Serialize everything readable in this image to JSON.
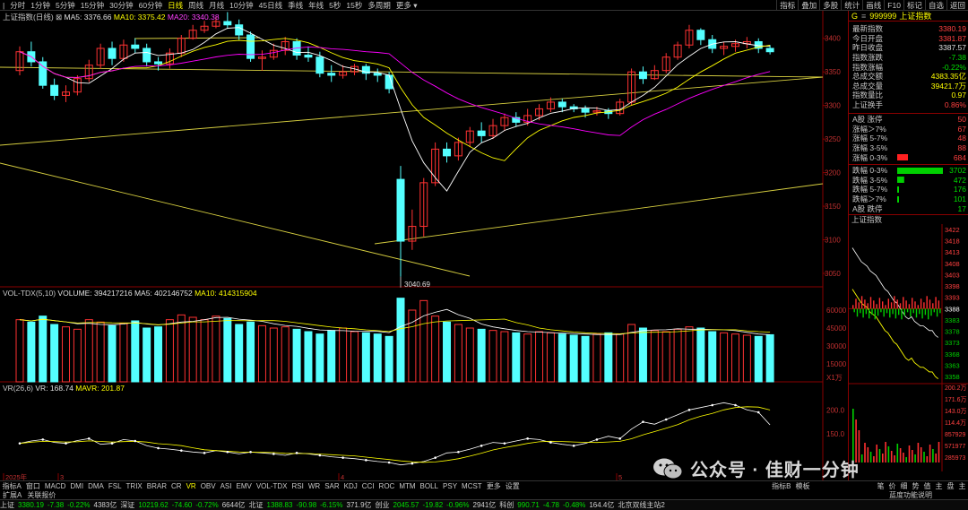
{
  "toolbar": {
    "timeframes": [
      "分时",
      "1分钟",
      "5分钟",
      "15分钟",
      "30分钟",
      "60分钟",
      "日线",
      "周线",
      "月线",
      "10分钟",
      "45日线",
      "季线",
      "年线",
      "5秒",
      "15秒",
      "多周期",
      "更多"
    ],
    "active_timeframe": "日线",
    "right_items": [
      "指标",
      "叠加",
      "多股",
      "统计",
      "画线",
      "F10",
      "标记",
      "自选",
      "返回"
    ]
  },
  "price_header": {
    "title": "上证指数(日线)",
    "ma5_label": "MA5: 3376.66",
    "ma10_label": "MA10: 3375.42",
    "ma20_label": "MA20: 3340.38",
    "high_label": "3439.05",
    "low_label": "3040.69"
  },
  "price_axis": [
    "3400",
    "3350",
    "3300",
    "3250",
    "3200",
    "3150",
    "3100",
    "3050"
  ],
  "vol_header": {
    "title": "VOL-TDX(5,10)",
    "volume": "VOLUME: 394217216",
    "ma5": "MA5: 402146752",
    "ma10": "MA10: 414315904"
  },
  "vol_axis": [
    "60000",
    "45000",
    "30000",
    "15000"
  ],
  "vol_unit": "X1万",
  "vr_header": {
    "title": "VR(26,6)",
    "vr": "VR: 168.74",
    "mavr": "MAVR: 201.87"
  },
  "vr_axis": [
    "200.0",
    "150.0"
  ],
  "date_labels": [
    "2025年",
    "3",
    "4",
    "5"
  ],
  "sidebar": {
    "code": "999999",
    "name": "上证指数",
    "stats": [
      {
        "label": "最新指数",
        "value": "3380.19",
        "color": "red"
      },
      {
        "label": "今日开盘",
        "value": "3381.87",
        "color": "red"
      },
      {
        "label": "昨日收盘",
        "value": "3387.57",
        "color": "white"
      },
      {
        "label": "指数涨跌",
        "value": "-7.38",
        "color": "green"
      },
      {
        "label": "指数涨幅",
        "value": "-0.22%",
        "color": "green"
      },
      {
        "label": "总成交额",
        "value": "4383.35亿",
        "color": "yellow"
      },
      {
        "label": "总成交量",
        "value": "39421.7万",
        "color": "yellow"
      },
      {
        "label": "指数量比",
        "value": "0.97",
        "color": "yellow"
      },
      {
        "label": "上证换手",
        "value": "0.86%",
        "color": "red"
      }
    ],
    "up_dist": [
      {
        "label": "A股 涨停",
        "value": "50",
        "pct": 0
      },
      {
        "label": "涨幅＞7%",
        "value": "67",
        "pct": 0
      },
      {
        "label": "涨幅 5-7%",
        "value": "48",
        "pct": 0
      },
      {
        "label": "涨幅 3-5%",
        "value": "88",
        "pct": 0
      },
      {
        "label": "涨幅 0-3%",
        "value": "684",
        "pct": 0.2
      }
    ],
    "down_dist": [
      {
        "label": "跌幅 0-3%",
        "value": "3702",
        "pct": 1.0
      },
      {
        "label": "跌幅 3-5%",
        "value": "472",
        "pct": 0.13
      },
      {
        "label": "跌幅 5-7%",
        "value": "176",
        "pct": 0.04
      },
      {
        "label": "跌幅＞7%",
        "value": "101",
        "pct": 0.02
      },
      {
        "label": "A股 跌停",
        "value": "17",
        "pct": 0
      }
    ],
    "mini_title": "上证指数",
    "mini_axis": [
      "3422",
      "3418",
      "3413",
      "3408",
      "3403",
      "3398",
      "3393",
      "3388",
      "3383",
      "3378",
      "3373",
      "3368",
      "3363",
      "3358"
    ],
    "mini_vol_axis": [
      "200.2万",
      "171.6万",
      "143.0万",
      "114.4万",
      "857929",
      "571977",
      "285973"
    ],
    "mini_tabs": [
      "笔",
      "价",
      "细",
      "势",
      "值",
      "主",
      "盘",
      "主"
    ]
  },
  "bottom_tabs": [
    "指标A",
    "窗口",
    "MACD",
    "DMI",
    "DMA",
    "FSL",
    "TRIX",
    "BRAR",
    "CR",
    "VR",
    "OBV",
    "ASI",
    "EMV",
    "VOL-TDX",
    "RSI",
    "WR",
    "SAR",
    "KDJ",
    "CCI",
    "ROC",
    "MTM",
    "BOLL",
    "PSY",
    "MCST",
    "更多",
    "设置"
  ],
  "active_bottom_tab": "VR",
  "bottom_right": [
    "指标B",
    "模板"
  ],
  "row2": [
    "扩展A",
    "关联报价"
  ],
  "row2_right": "蓝度功能说明",
  "status": [
    {
      "text": "上证",
      "color": "white"
    },
    {
      "text": "3380.19",
      "color": "green"
    },
    {
      "text": "-7.38",
      "color": "green"
    },
    {
      "text": "-0.22%",
      "color": "green"
    },
    {
      "text": "4383亿",
      "color": "white"
    },
    {
      "text": "深证",
      "color": "white"
    },
    {
      "text": "10219.62",
      "color": "green"
    },
    {
      "text": "-74.60",
      "color": "green"
    },
    {
      "text": "-0.72%",
      "color": "green"
    },
    {
      "text": "6644亿",
      "color": "white"
    },
    {
      "text": "北证",
      "color": "white"
    },
    {
      "text": "1388.83",
      "color": "green"
    },
    {
      "text": "-90.98",
      "color": "green"
    },
    {
      "text": "-6.15%",
      "color": "green"
    },
    {
      "text": "371.9亿",
      "color": "white"
    },
    {
      "text": "创业",
      "color": "white"
    },
    {
      "text": "2045.57",
      "color": "green"
    },
    {
      "text": "-19.82",
      "color": "green"
    },
    {
      "text": "-0.96%",
      "color": "green"
    },
    {
      "text": "2941亿",
      "color": "white"
    },
    {
      "text": "科创",
      "color": "white"
    },
    {
      "text": "990.71",
      "color": "green"
    },
    {
      "text": "-4.78",
      "color": "green"
    },
    {
      "text": "-0.48%",
      "color": "green"
    },
    {
      "text": "164.4亿",
      "color": "white"
    },
    {
      "text": "北京双线主站2",
      "color": "white"
    }
  ],
  "watermark": "公众号 · 佳财一分钟",
  "colors": {
    "up": "#ff3232",
    "down": "#54ffff",
    "ma5": "#ffffff",
    "ma10": "#ffff00",
    "ma20": "#ff00ff",
    "trend": "#d8d040"
  }
}
